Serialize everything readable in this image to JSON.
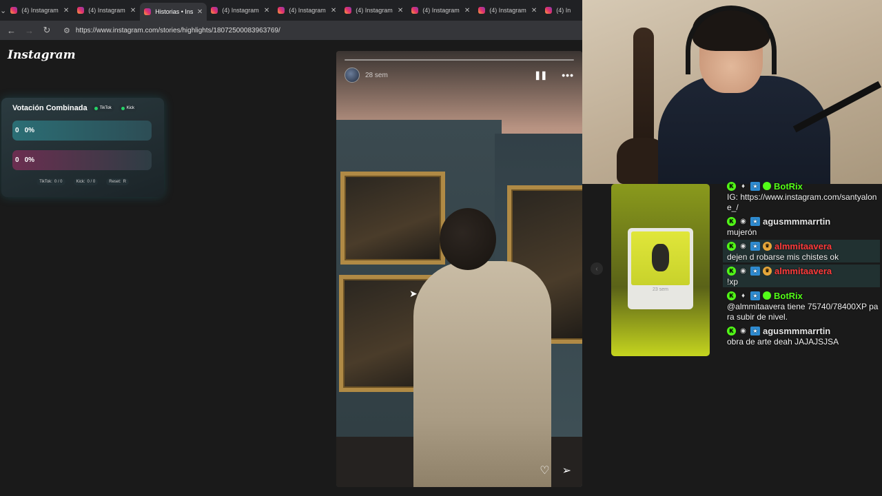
{
  "browser": {
    "tabs": [
      {
        "title": "(4) Instagram",
        "active": false
      },
      {
        "title": "(4) Instagram",
        "active": false
      },
      {
        "title": "Historias • Ins",
        "active": true
      },
      {
        "title": "(4) Instagram",
        "active": false
      },
      {
        "title": "(4) Instagram",
        "active": false
      },
      {
        "title": "(4) Instagram",
        "active": false
      },
      {
        "title": "(4) Instagram",
        "active": false
      },
      {
        "title": "(4) Instagram",
        "active": false
      },
      {
        "title": "(4) In",
        "active": false
      }
    ],
    "url": "https://www.instagram.com/stories/highlights/18072500083963769/",
    "icons": {
      "back": "back-arrow-icon",
      "forward": "forward-arrow-icon",
      "reload": "reload-icon",
      "site_info": "tune-icon"
    }
  },
  "instagram": {
    "logo": "Instagram"
  },
  "vote_widget": {
    "title": "Votación Combinada",
    "platforms": [
      "TikTok",
      "Kick"
    ],
    "options": [
      {
        "count": "0",
        "percent": "0%"
      },
      {
        "count": "0",
        "percent": "0%"
      }
    ],
    "footer": [
      {
        "label": "TikTok:",
        "value": "0 / 0"
      },
      {
        "label": "Kick:",
        "value": "0 / 0"
      },
      {
        "label": "Reset:",
        "value": "R"
      }
    ]
  },
  "story": {
    "time": "28 sem",
    "icons": {
      "pause": "pause-icon",
      "more": "more-icon",
      "like": "heart-icon",
      "share": "send-icon"
    }
  },
  "next_preview": {
    "time": "23 sem"
  },
  "chat": {
    "messages": [
      {
        "user": "BotRix",
        "color": "green",
        "text": "IG: https://www.instagram.com/santyalone_/",
        "highlight": false
      },
      {
        "user": "agusmmmarrtin",
        "color": "gray",
        "text": "mujerón",
        "highlight": false
      },
      {
        "user": "almmitaavera",
        "color": "red",
        "text": "dejen d robarse mis chistes ok",
        "highlight": true
      },
      {
        "user": "almmitaavera",
        "color": "red",
        "text": "!xp",
        "highlight": true
      },
      {
        "user": "BotRix",
        "color": "green",
        "text": "@almmitaavera tiene 75740/78400XP para subir de nivel.",
        "highlight": false
      },
      {
        "user": "agusmmmarrtin",
        "color": "gray",
        "text": "obra de arte deah JAJAJSJSA",
        "highlight": false
      }
    ]
  },
  "colors": {
    "kick_green": "#53fc18",
    "tab_bg": "#202124",
    "toolbar_bg": "#35363a"
  }
}
